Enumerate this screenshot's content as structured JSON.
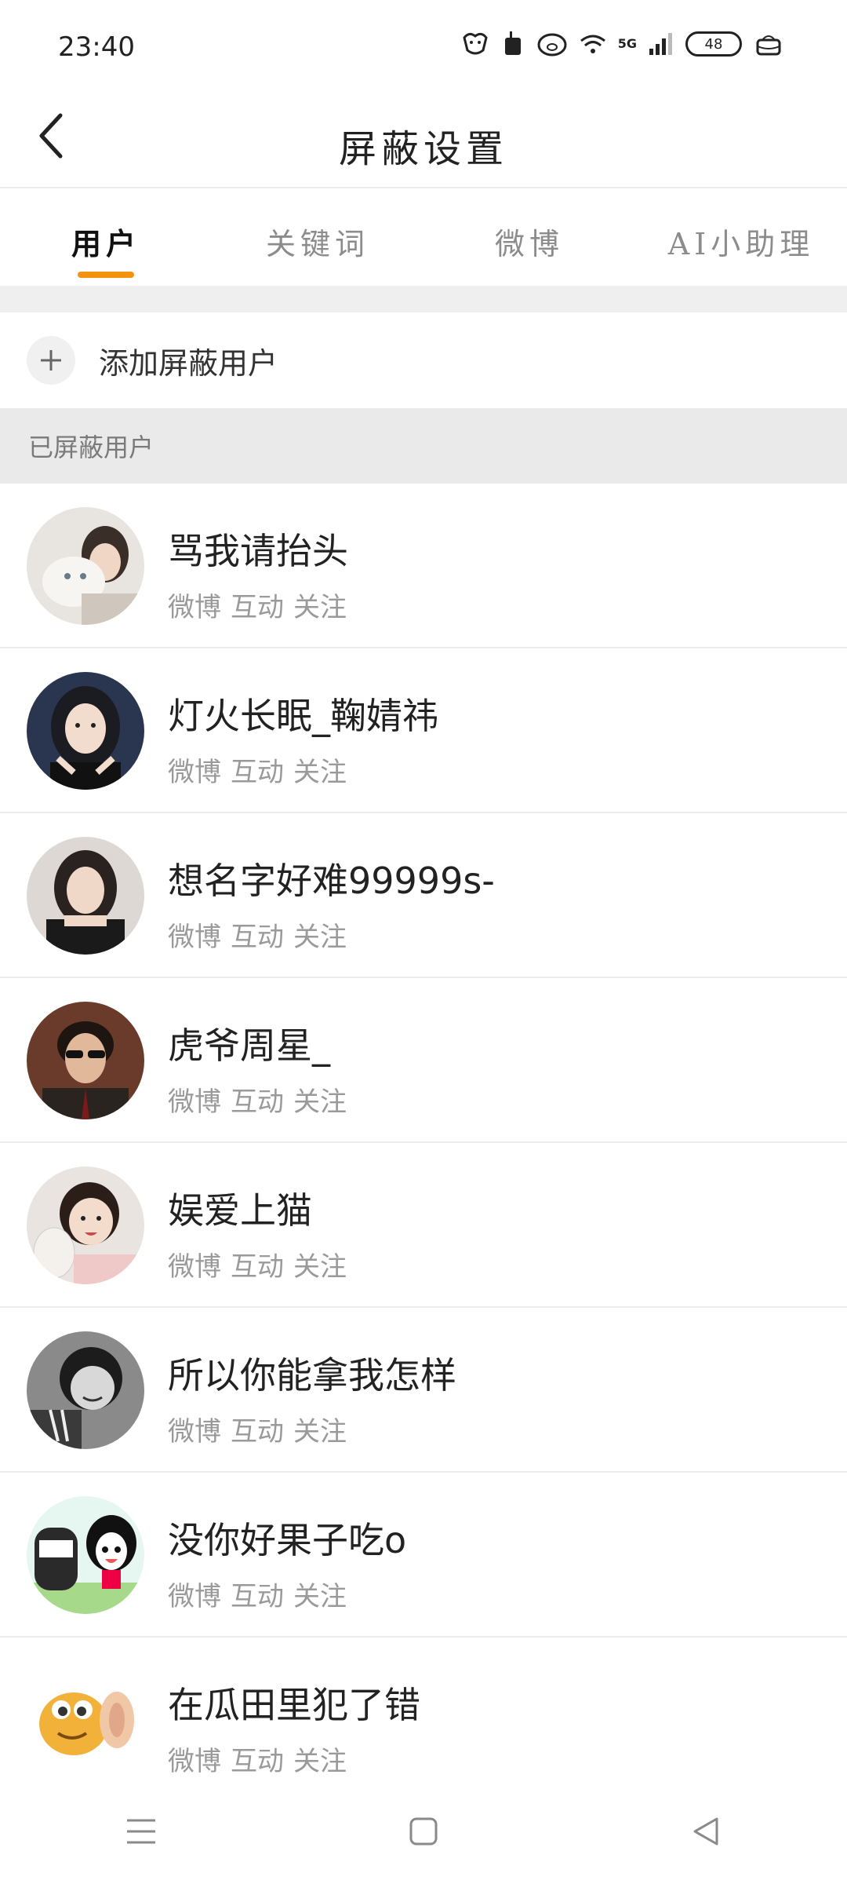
{
  "status_bar": {
    "time": "23:40",
    "network": "5G",
    "battery": "48"
  },
  "header": {
    "title": "屏蔽设置"
  },
  "tabs": [
    {
      "label": "用户",
      "active": true
    },
    {
      "label": "关键词",
      "active": false
    },
    {
      "label": "微博",
      "active": false
    },
    {
      "label": "AI小助理",
      "active": false
    }
  ],
  "add_row": {
    "label": "添加屏蔽用户"
  },
  "section": {
    "label": "已屏蔽用户"
  },
  "users": [
    {
      "name": "骂我请抬头",
      "tags": [
        "微博",
        "互动",
        "关注"
      ]
    },
    {
      "name": "灯火长眠_鞠婧祎",
      "tags": [
        "微博",
        "互动",
        "关注"
      ]
    },
    {
      "name": "想名字好难99999s-",
      "tags": [
        "微博",
        "互动",
        "关注"
      ]
    },
    {
      "name": "虎爷周星_",
      "tags": [
        "微博",
        "互动",
        "关注"
      ]
    },
    {
      "name": "娱爱上猫",
      "tags": [
        "微博",
        "互动",
        "关注"
      ]
    },
    {
      "name": "所以你能拿我怎样",
      "tags": [
        "微博",
        "互动",
        "关注"
      ]
    },
    {
      "name": "没你好果子吃o",
      "tags": [
        "微博",
        "互动",
        "关注"
      ]
    },
    {
      "name": "在瓜田里犯了错",
      "tags": [
        "微博",
        "互动",
        "关注"
      ]
    }
  ],
  "colors": {
    "accent": "#f4920f",
    "divider": "#ececec",
    "section_bg": "#eaeaea"
  },
  "icons": {
    "back": "chevron-left-icon",
    "add": "plus-icon",
    "nav": [
      "menu-icon",
      "home-square-icon",
      "back-triangle-icon"
    ]
  }
}
